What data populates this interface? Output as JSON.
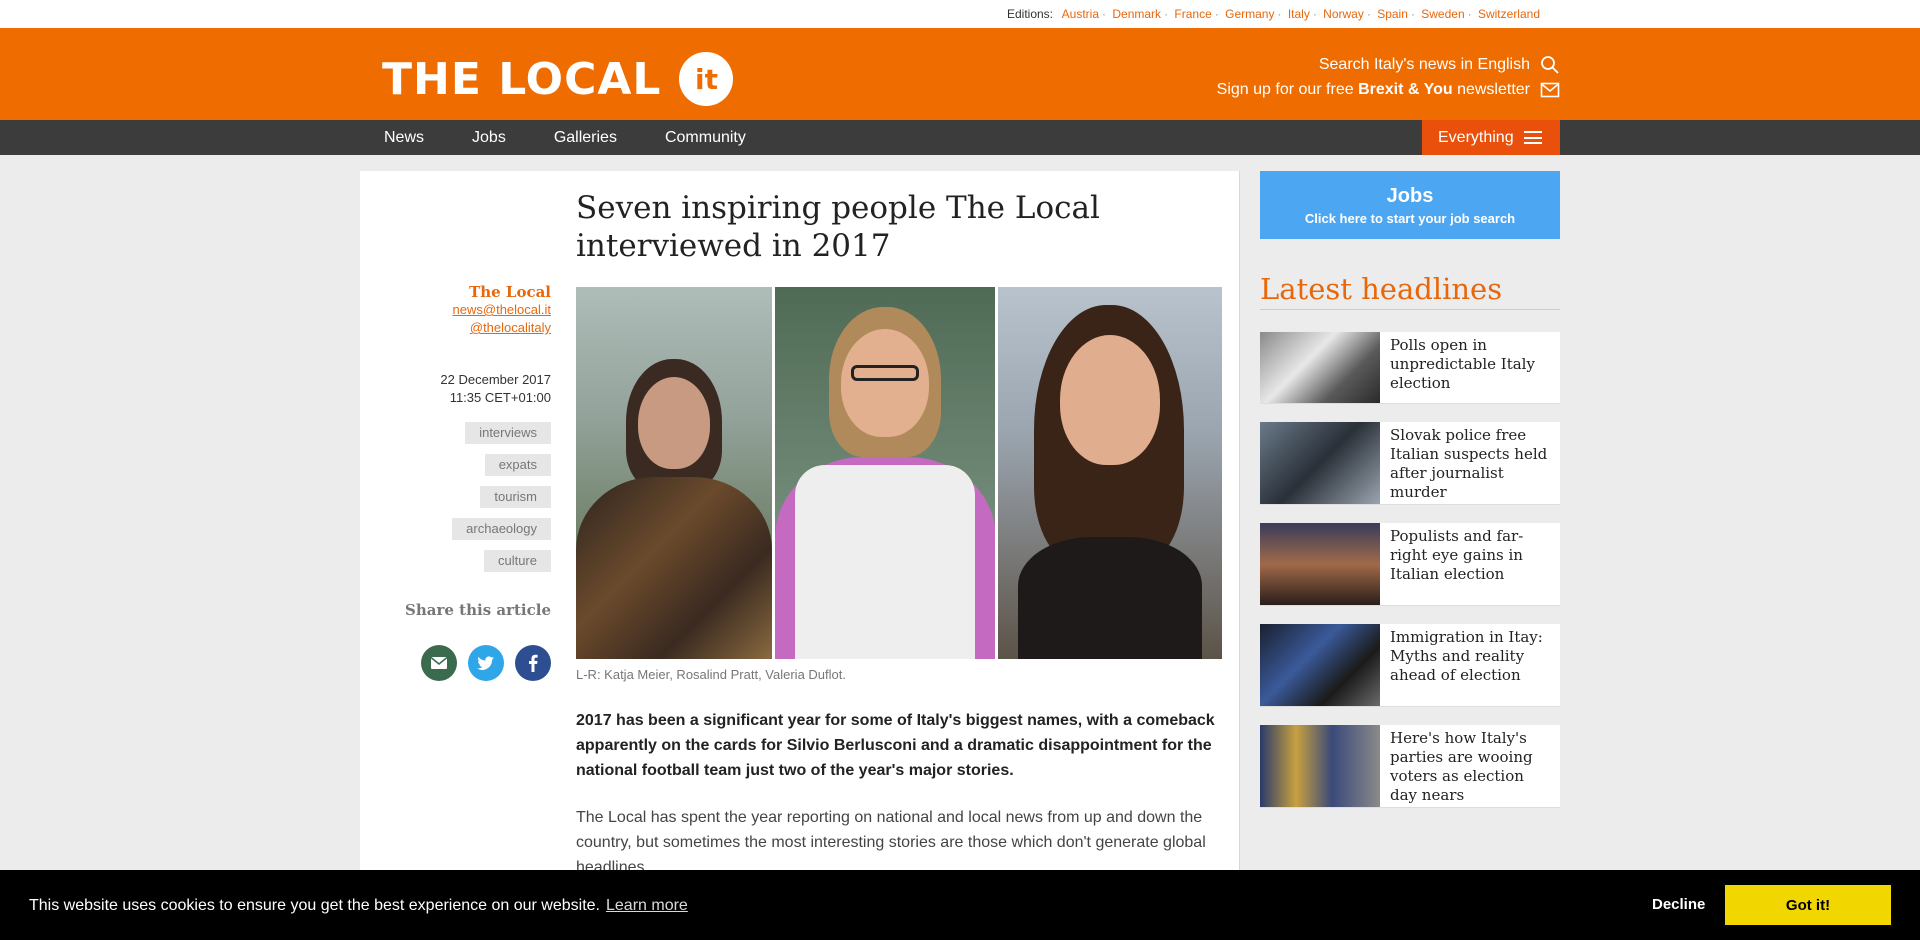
{
  "editions": {
    "label": "Editions:",
    "items": [
      "Austria",
      "Denmark",
      "France",
      "Germany",
      "Italy",
      "Norway",
      "Spain",
      "Sweden",
      "Switzerland"
    ]
  },
  "header": {
    "logo_text": "THE LOCAL",
    "logo_badge": "it",
    "search_text": "Search Italy's news in English",
    "newsletter_prefix": "Sign up for our free",
    "newsletter_bold": "Brexit & You",
    "newsletter_suffix": "newsletter",
    "brand_color": "#ef6c00"
  },
  "nav": {
    "items": [
      "News",
      "Jobs",
      "Galleries",
      "Community"
    ],
    "everything_label": "Everything"
  },
  "article": {
    "headline": "Seven inspiring people The Local interviewed in 2017",
    "author_name": "The Local",
    "author_email": "news@thelocal.it",
    "author_handle": "@thelocalitaly",
    "date": "22 December 2017",
    "time": "11:35 CET+01:00",
    "tags": [
      "interviews",
      "expats",
      "tourism",
      "archaeology",
      "culture"
    ],
    "share_title": "Share this article",
    "caption": "L-R: Katja Meier, Rosalind Pratt, Valeria Duflot.",
    "lead": "2017 has been a significant year for some of Italy's biggest names, with a comeback apparently on the cards for Silvio Berlusconi and a dramatic disappointment for the national football team just two of the year's major stories.",
    "para": "The Local has spent the year reporting on national and local news from up and down the country, but sometimes the most interesting stories are those which don't generate global headlines."
  },
  "sidebar": {
    "jobs_title": "Jobs",
    "jobs_subtitle": "Click here to start your job search",
    "latest_title": "Latest headlines",
    "headlines": [
      "Polls open in unpredictable Italy election",
      "Slovak police free Italian suspects held after journalist murder",
      "Populists and far-right eye gains in Italian election",
      "Immigration in Itay: Myths and reality ahead of election",
      "Here's how Italy's parties are wooing voters as election day nears"
    ]
  },
  "cookie": {
    "message": "This website uses cookies to ensure you get the best experience on our website.",
    "learn_more": "Learn more",
    "decline": "Decline",
    "accept": "Got it!"
  }
}
